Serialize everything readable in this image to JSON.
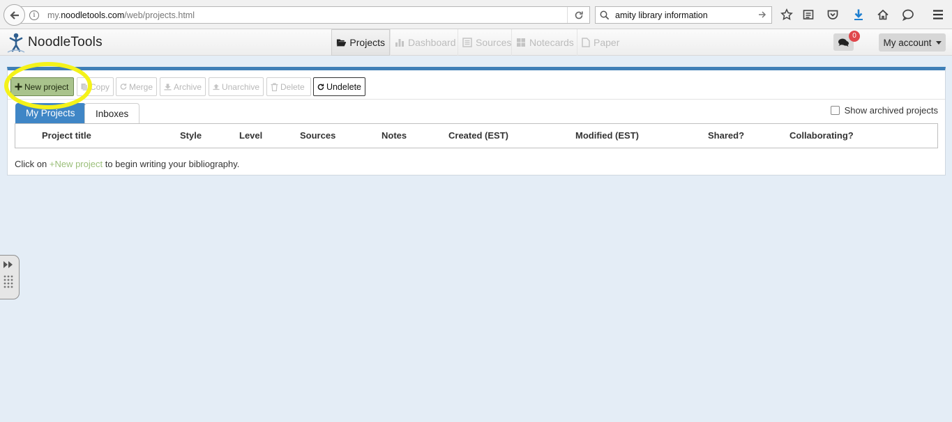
{
  "browser": {
    "url_prefix": "my.",
    "url_domain": "noodletools.com",
    "url_path": "/web/projects.html",
    "search_query": "amity library information"
  },
  "header": {
    "logo_text": "NoodleTools",
    "nav": [
      {
        "label": "Projects",
        "icon": "folder-open-icon",
        "active": true
      },
      {
        "label": "Dashboard",
        "icon": "bar-chart-icon",
        "active": false
      },
      {
        "label": "Sources",
        "icon": "list-icon",
        "active": false
      },
      {
        "label": "Notecards",
        "icon": "grid-icon",
        "active": false
      },
      {
        "label": "Paper",
        "icon": "document-icon",
        "active": false
      }
    ],
    "chat_badge_count": "0",
    "account_label": "My account"
  },
  "toolbar": {
    "new_project": "New project",
    "copy": "Copy",
    "merge": "Merge",
    "archive": "Archive",
    "unarchive": "Unarchive",
    "delete": "Delete",
    "undelete": "Undelete"
  },
  "tabs": {
    "my_projects": "My Projects",
    "inboxes": "Inboxes"
  },
  "show_archived_label": "Show archived projects",
  "table": {
    "columns": [
      "Project title",
      "Style",
      "Level",
      "Sources",
      "Notes",
      "Created (EST)",
      "Modified (EST)",
      "Shared?",
      "Collaborating?"
    ]
  },
  "empty_message": {
    "before": "Click on ",
    "link": "+New project",
    "after": " to begin writing your bibliography."
  },
  "colors": {
    "panel_accent": "#3f7fb7",
    "active_tab": "#3f86c6",
    "new_project_button": "#a9c38c",
    "highlight": "#f4f21a",
    "badge": "#e0474c"
  }
}
